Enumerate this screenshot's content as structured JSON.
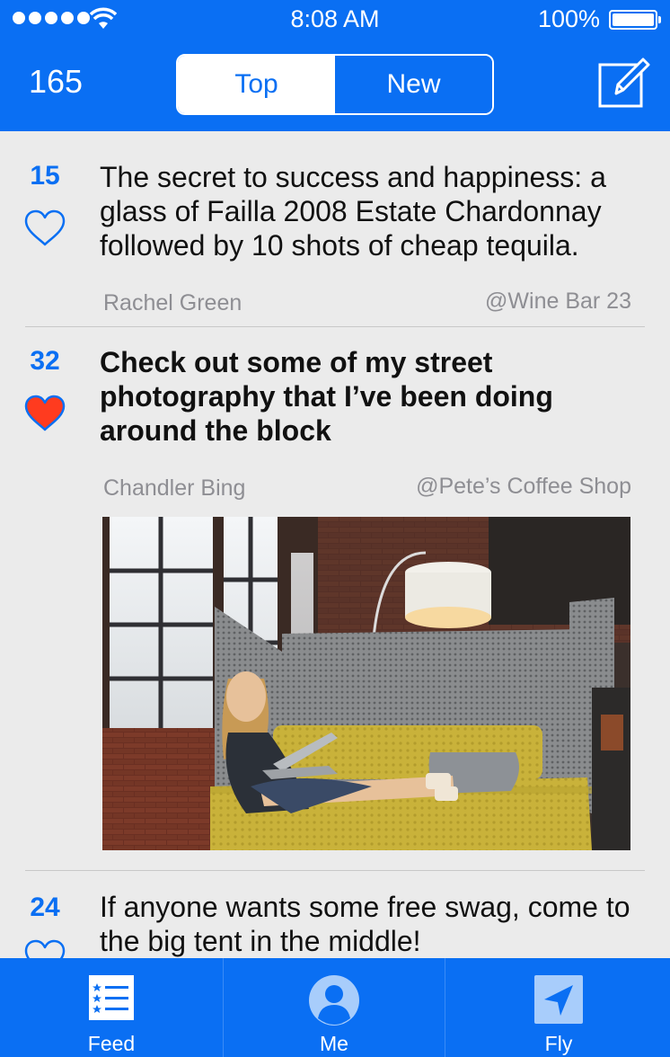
{
  "status_bar": {
    "time": "8:08 AM",
    "battery": "100%"
  },
  "header": {
    "count": "165",
    "tabs": [
      {
        "label": "Top",
        "active": true
      },
      {
        "label": "New",
        "active": false
      }
    ]
  },
  "posts": [
    {
      "votes": "15",
      "liked": false,
      "text": "The secret to success and happiness: a glass of Failla 2008 Estate Chardonnay followed by 10 shots of cheap tequila.",
      "author": "Rachel Green",
      "location": "@Wine Bar 23"
    },
    {
      "votes": "32",
      "liked": true,
      "text": "Check out some of my street photography that I’ve been doing around the block",
      "author": "Chandler Bing",
      "location": "@Pete’s Coffee Shop",
      "has_photo": true
    },
    {
      "votes": "24",
      "liked": false,
      "text": "If anyone wants some free swag, come to the big tent in the middle!"
    }
  ],
  "tab_bar": {
    "items": [
      {
        "label": "Feed"
      },
      {
        "label": "Me"
      },
      {
        "label": "Fly"
      }
    ]
  },
  "colors": {
    "brand": "#0a6ff3",
    "liked_heart": "#ff3b1f",
    "background": "#ebebeb"
  }
}
